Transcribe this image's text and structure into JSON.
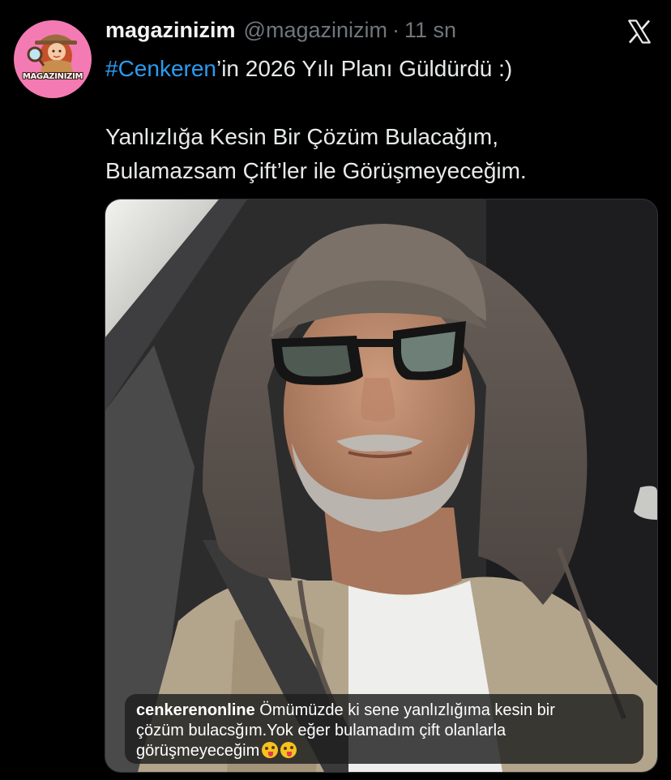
{
  "author": {
    "display_name": "magazinizim",
    "handle": "@magazinizim",
    "separator": "·",
    "time": "11 sn",
    "avatar_text": "MAGAZINIZIM"
  },
  "brand": {
    "logo_icon": "x-logo-icon",
    "accent_color": "#2b9bf0",
    "avatar_bg": "#f47ab4"
  },
  "tweet": {
    "hashtag": "#Cenkeren",
    "line1_rest": "’in 2026 Yılı Planı Güldürdü :)",
    "line2": "Yanlızlığa Kesin Bir Çözüm Bulacağım,",
    "line3": "Bulamazsam Çift’ler ile Görüşmeyeceğim."
  },
  "media": {
    "photo_icon": "selfie-photo",
    "comment": {
      "username": "cenkerenonline",
      "text_line1": " Ömümüzde ki sene yanlızlığıma kesin bir",
      "text_line2": "çözüm bulacsğım.Yok eğer bulamadım çift olanlarla",
      "text_line3": "görüşmeyeceğim",
      "emoji_icon": "zany-face-emoji"
    }
  }
}
